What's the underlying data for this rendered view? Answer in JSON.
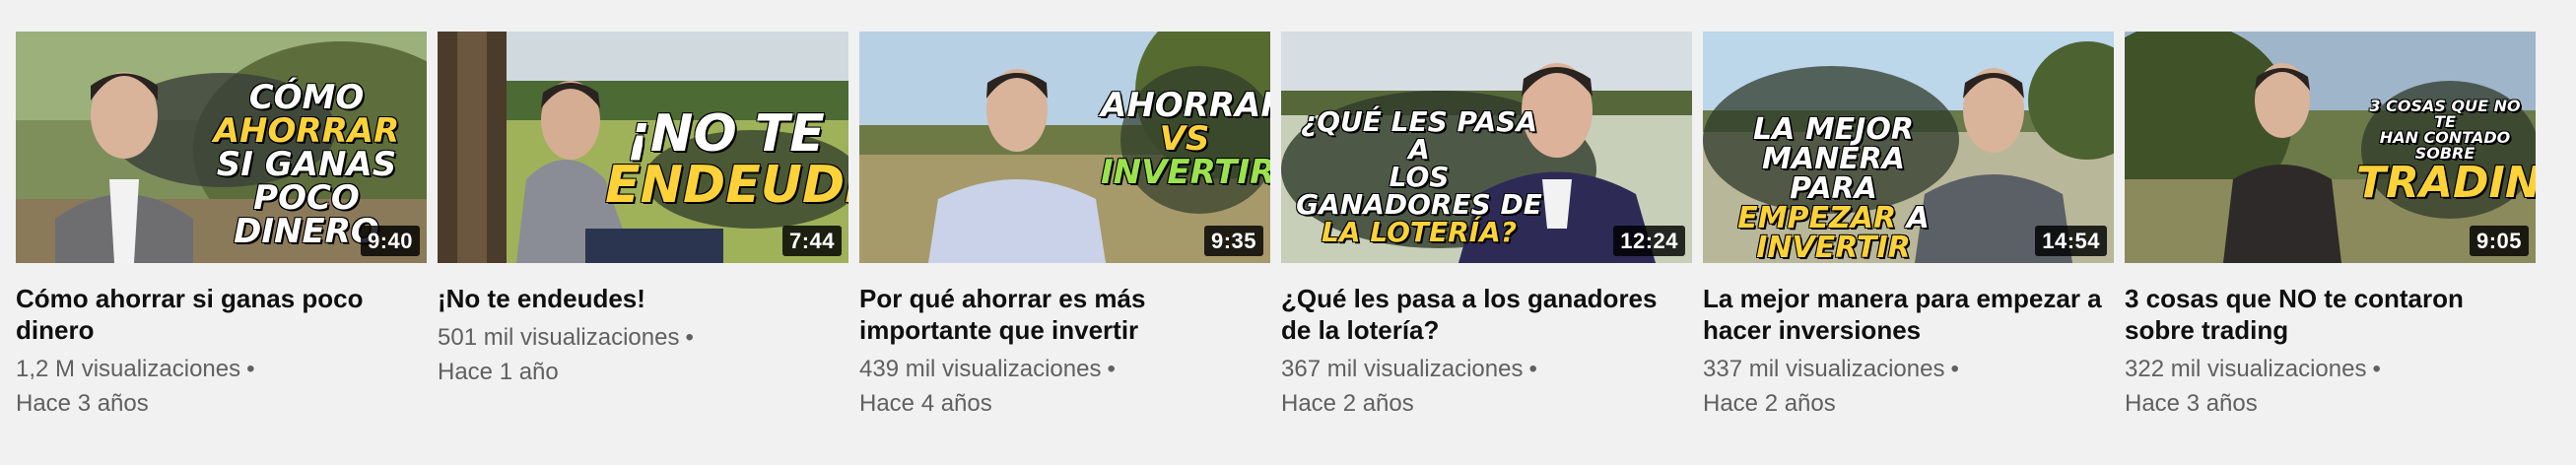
{
  "videos": [
    {
      "overlay_lines": [
        "Cómo",
        "ahorrar",
        "si ganas poco",
        "dinero"
      ],
      "duration": "9:40",
      "title": "Cómo ahorrar si ganas poco dinero",
      "views": "1,2 M visualizaciones",
      "separator": "•",
      "age": "Hace 3 años"
    },
    {
      "overlay_lines": [
        "¡No te",
        "endeudes!"
      ],
      "duration": "7:44",
      "title": "¡No te endeudes!",
      "views": "501 mil visualizaciones",
      "separator": "•",
      "age": "Hace 1 año"
    },
    {
      "overlay_lines": [
        "Ahorrar",
        "vs",
        "invertir"
      ],
      "duration": "9:35",
      "title": "Por qué ahorrar es más importante que invertir",
      "views": "439 mil visualizaciones",
      "separator": "•",
      "age": "Hace 4 años"
    },
    {
      "overlay_lines": [
        "¿Qué les pasa a",
        "los ganadores de",
        "la lotería?"
      ],
      "duration": "12:24",
      "title": "¿Qué les pasa a los ganadores de la lotería?",
      "views": "367 mil visualizaciones",
      "separator": "•",
      "age": "Hace 2 años"
    },
    {
      "overlay_lines": [
        "La mejor manera",
        "para",
        "empezar",
        "a",
        "invertir"
      ],
      "duration": "14:54",
      "title": "La mejor manera para empezar a hacer inversiones",
      "views": "337 mil visualizaciones",
      "separator": "•",
      "age": "Hace 2 años"
    },
    {
      "overlay_lines": [
        "3 cosas que no te",
        "han contado sobre",
        "trading"
      ],
      "duration": "9:05",
      "title": "3 cosas que NO te contaron sobre trading",
      "views": "322 mil visualizaciones",
      "separator": "•",
      "age": "Hace 3 años"
    }
  ],
  "colors": {
    "highlight_yellow": "#ffd23a",
    "highlight_green": "#9be24f",
    "duration_bg": "#000000"
  }
}
